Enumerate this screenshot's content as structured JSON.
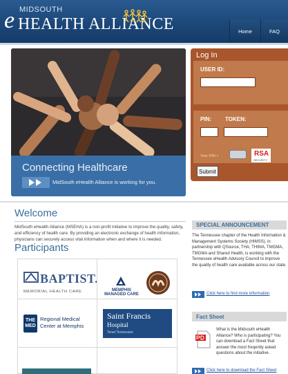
{
  "header": {
    "logo_small": "MIDSOUTH",
    "logo_e": "e",
    "logo_main": "HEALTH ALLIANCE",
    "nav": [
      {
        "label": "Home"
      },
      {
        "label": "FAQ"
      }
    ]
  },
  "hero": {
    "title": "Connecting Healthcare",
    "subtitle": "MidSouth eHealth Alliance is working for you."
  },
  "login": {
    "title": "Log In",
    "user_id_label": "USER ID:",
    "pin_label": "PIN:",
    "token_label": "TOKEN:",
    "your_pin_text": "Your PIN  +",
    "rsa_logo": "RSA",
    "rsa_sub": "SECURITY",
    "submit_label": "Submit"
  },
  "welcome": {
    "heading": "Welcome",
    "text": "MidSouth eHealth Alliance (MSEHA) is a non-profit initiative to improve the quality, safety, and efficiency of health care. By providing an electronic exchange of health information, physicians can securely access vital information when and where it is needed."
  },
  "participants": {
    "heading": "Participants",
    "items": [
      {
        "name": "BAPTIST.",
        "sub": "MEMORIAL HEALTH CARE"
      },
      {
        "name": "MEMPHIS MANAGED CARE"
      },
      {
        "badge": "THE MED",
        "name": "Regional Medical Center at Memphis"
      },
      {
        "name": "Saint Francis",
        "sub": "Hospital",
        "tag": "Tenet Tennessee"
      }
    ]
  },
  "announcement": {
    "heading": "SPECIAL ANNOUNCEMENT",
    "text": "The Tennessee chapter of the Health Information & Management Systems Society (HIMSS), in partnership with QSource, THA, THIMA, TMGMA, TMGMA and Shared Health, is working with the Tennessee eHealth Advisory Council to improve the quality of health care available across our state.",
    "link": "Click here to find more information"
  },
  "fact_sheet": {
    "heading": "Fact Sheet",
    "text": "What is the Midsouth eHealth Alliance? Who is participating? You can download a Fact Sheet that answer the most freqently asked questions about the initiative.",
    "link": "Click here to download the Fact Sheet"
  },
  "colors": {
    "header": "#1b4677",
    "login_panel": "#a9562c",
    "heading_blue": "#3b6e9c",
    "link_blue": "#1d4f9e"
  }
}
